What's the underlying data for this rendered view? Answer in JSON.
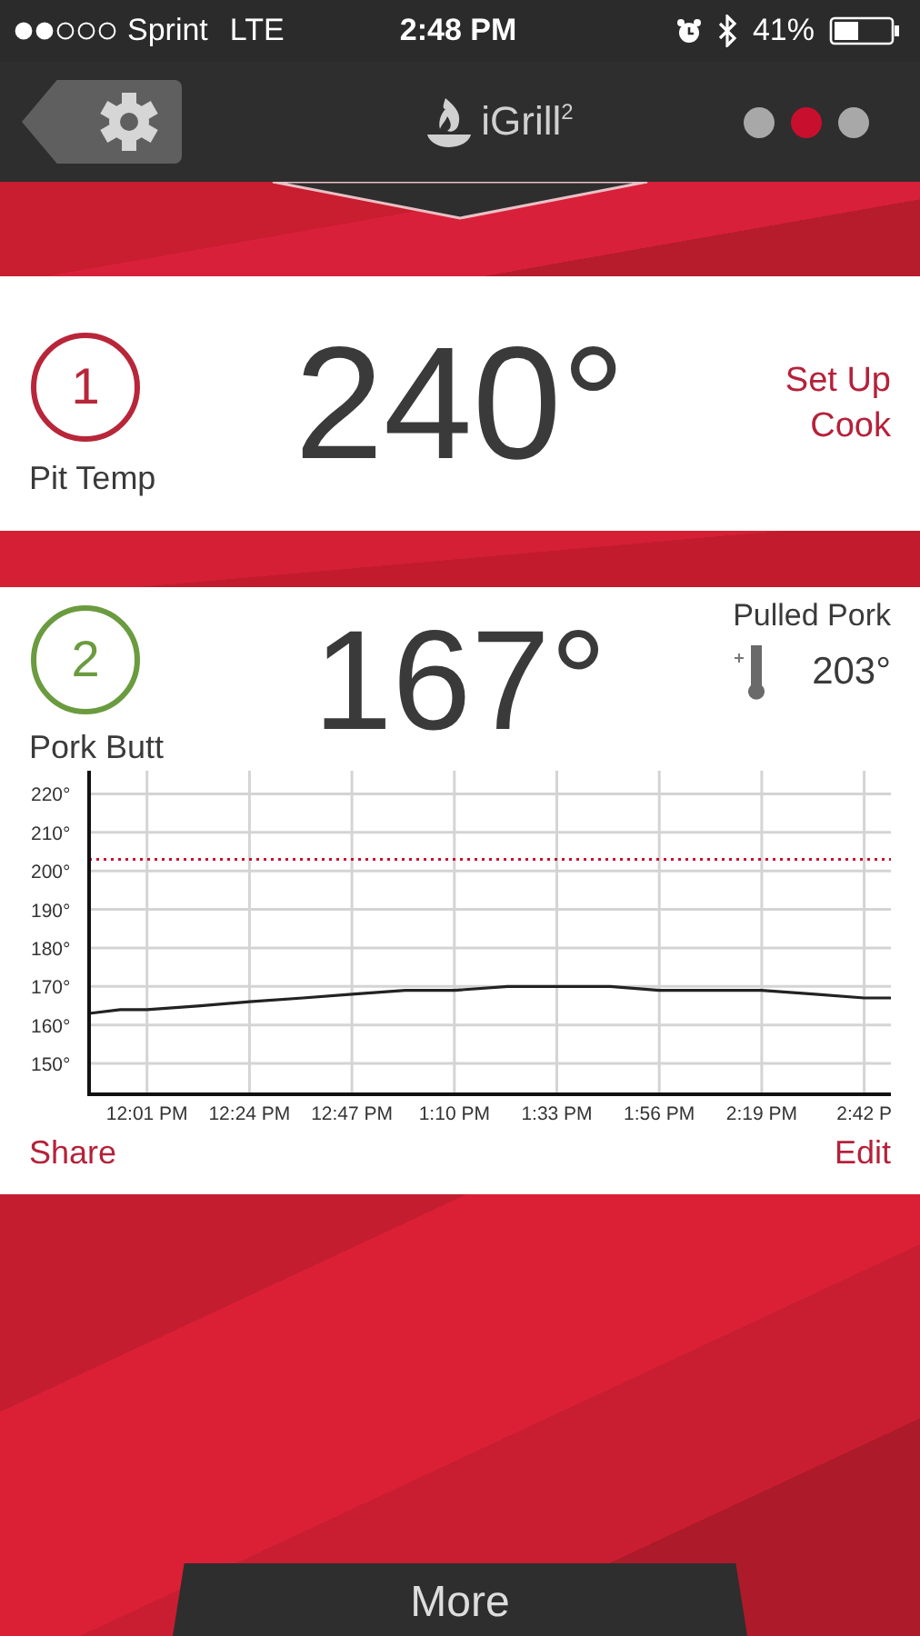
{
  "status_bar": {
    "carrier": "Sprint",
    "network": "LTE",
    "time": "2:48 PM",
    "battery": "41%"
  },
  "nav": {
    "logo": "iGrill$^{2}$",
    "pages": [
      {
        "selected": false
      },
      {
        "selected": true
      },
      {
        "selected": false
      }
    ]
  },
  "probes": [
    {
      "kind": "ambient",
      "number": "1",
      "name": "Pit Temp",
      "temp": "240°",
      "color": "#b8263a",
      "action": "Set Up Cook"
    },
    {
      "kind": "food",
      "number": "2",
      "name": "Pork Butt",
      "temp": "167°",
      "color": "#6b9b3f",
      "preset": "Pulled Pork",
      "target": "203°",
      "share": "Share",
      "edit": "Edit",
      "chart_data": {
        "type": "line",
        "x": [
          708,
          715,
          721,
          733,
          744,
          756,
          767,
          779,
          790,
          802,
          813,
          825,
          836,
          848,
          859,
          871,
          882,
          888
        ],
        "series": [
          {
            "color": "#222222",
            "values": [
              163,
              164,
              164,
              165,
              166,
              167,
              168,
              169,
              169,
              170,
              170,
              170,
              169,
              169,
              169,
              168,
              167,
              167
            ]
          }
        ],
        "xlim": [
          708,
          888
        ],
        "ylim": [
          142,
          226
        ],
        "xticks": [
          {
            "value": 721,
            "label": "12:01 PM"
          },
          {
            "value": 744,
            "label": "12:24 PM"
          },
          {
            "value": 767,
            "label": "12:47 PM"
          },
          {
            "value": 790,
            "label": "1:10 PM"
          },
          {
            "value": 813,
            "label": "1:33 PM"
          },
          {
            "value": 836,
            "label": "1:56 PM"
          },
          {
            "value": 859,
            "label": "2:19 PM"
          },
          {
            "value": 882,
            "label": "2:42 P"
          }
        ],
        "yticks": [
          {
            "value": 150,
            "label": "150°"
          },
          {
            "value": 160,
            "label": "160°"
          },
          {
            "value": 170,
            "label": "170°"
          },
          {
            "value": 180,
            "label": "180°"
          },
          {
            "value": 190,
            "label": "190°"
          },
          {
            "value": 200,
            "label": "200°"
          },
          {
            "value": 210,
            "label": "210°"
          },
          {
            "value": 220,
            "label": "220°"
          }
        ],
        "grid": true,
        "ref_lines": [
          {
            "axis": "y",
            "value": 203,
            "color": "#c8102e"
          }
        ]
      }
    }
  ],
  "footer": {
    "more": "More"
  }
}
